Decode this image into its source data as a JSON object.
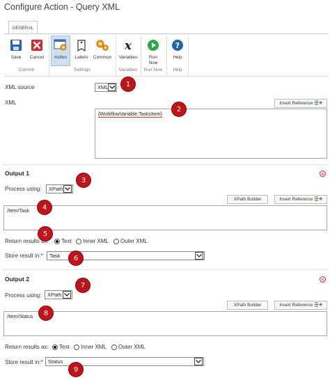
{
  "window": {
    "title": "Configure Action - Query XML"
  },
  "ribbon": {
    "tab": "GENERAL",
    "buttons": {
      "save": "Save",
      "cancel": "Cancel",
      "action": "Action",
      "labels": "Labels",
      "common": "Common",
      "variables": "Variables",
      "run_now_1": "Run",
      "run_now_2": "Now",
      "help": "Help"
    },
    "groups": {
      "commit": "Commit",
      "settings": "Settings",
      "variables": "Variables",
      "run_now": "Run Now",
      "help": "Help"
    }
  },
  "form": {
    "xml_source_label": "XML source",
    "xml_source_value": "XML",
    "xml_label": "XML",
    "insert_reference": "Insert Reference",
    "xml_value": "{WorkflowVariable:TasksItem}"
  },
  "output1": {
    "header": "Output 1",
    "process_using_label": "Process using:",
    "process_using_value": "XPath",
    "xpath_builder": "XPath Builder",
    "insert_reference": "Insert Reference",
    "xpath_value": "/Item/Task",
    "return_results_label": "Return results as:",
    "opt_text": "Text",
    "opt_inner": "Inner XML",
    "opt_outer": "Outer XML",
    "store_result_label": "Store result in:",
    "required_mark": "*",
    "store_result_value": "Task"
  },
  "output2": {
    "header": "Output 2",
    "process_using_label": "Process using:",
    "process_using_value": "XPath",
    "xpath_builder": "XPath Builder",
    "insert_reference": "Insert Reference",
    "xpath_value": "/Item/Status",
    "return_results_label": "Return results as:",
    "opt_text": "Text",
    "opt_inner": "Inner XML",
    "opt_outer": "Outer XML",
    "store_result_label": "Store result in:",
    "required_mark": "*",
    "store_result_value": "Status"
  },
  "callouts": [
    "1",
    "2",
    "3",
    "4",
    "5",
    "6",
    "7",
    "8",
    "9"
  ],
  "colors": {
    "callout": "#c0141b",
    "selected_button": "#cde0f3",
    "remove_icon": "#d0202a"
  }
}
